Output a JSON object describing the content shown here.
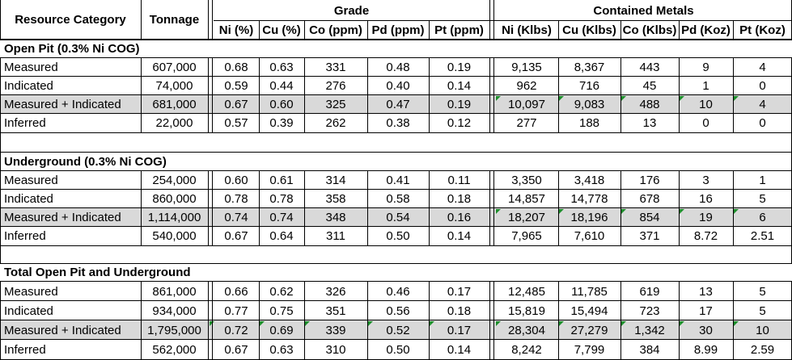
{
  "table": {
    "headers": {
      "resource_category": "Resource Category",
      "tonnage": "Tonnage",
      "grade_group": "Grade",
      "contained_group": "Contained Metals",
      "grade_columns": [
        "Ni (%)",
        "Cu (%)",
        "Co (ppm)",
        "Pd (ppm)",
        "Pt (ppm)"
      ],
      "contained_columns": [
        "Ni (Klbs)",
        "Cu (Klbs)",
        "Co (Klbs)",
        "Pd (Koz)",
        "Pt (Koz)"
      ]
    },
    "sections": [
      {
        "title": "Open Pit (0.3% Ni COG)",
        "rows": [
          {
            "category": "Measured",
            "tonnage": "607,000",
            "grade": [
              "0.68",
              "0.63",
              "331",
              "0.48",
              "0.19"
            ],
            "contained": [
              "9,135",
              "8,367",
              "443",
              "9",
              "4"
            ]
          },
          {
            "category": "Indicated",
            "tonnage": "74,000",
            "grade": [
              "0.59",
              "0.44",
              "276",
              "0.40",
              "0.14"
            ],
            "contained": [
              "962",
              "716",
              "45",
              "1",
              "0"
            ]
          },
          {
            "category": "Measured + Indicated",
            "tonnage": "681,000",
            "grade": [
              "0.67",
              "0.60",
              "325",
              "0.47",
              "0.19"
            ],
            "contained": [
              "10,097",
              "9,083",
              "488",
              "10",
              "4"
            ]
          },
          {
            "category": "Inferred",
            "tonnage": "22,000",
            "grade": [
              "0.57",
              "0.39",
              "262",
              "0.38",
              "0.12"
            ],
            "contained": [
              "277",
              "188",
              "13",
              "0",
              "0"
            ]
          }
        ]
      },
      {
        "title": "Underground (0.3% Ni COG)",
        "rows": [
          {
            "category": "Measured",
            "tonnage": "254,000",
            "grade": [
              "0.60",
              "0.61",
              "314",
              "0.41",
              "0.11"
            ],
            "contained": [
              "3,350",
              "3,418",
              "176",
              "3",
              "1"
            ]
          },
          {
            "category": "Indicated",
            "tonnage": "860,000",
            "grade": [
              "0.78",
              "0.78",
              "358",
              "0.58",
              "0.18"
            ],
            "contained": [
              "14,857",
              "14,778",
              "678",
              "16",
              "5"
            ]
          },
          {
            "category": "Measured + Indicated",
            "tonnage": "1,114,000",
            "grade": [
              "0.74",
              "0.74",
              "348",
              "0.54",
              "0.16"
            ],
            "contained": [
              "18,207",
              "18,196",
              "854",
              "19",
              "6"
            ]
          },
          {
            "category": "Inferred",
            "tonnage": "540,000",
            "grade": [
              "0.67",
              "0.64",
              "311",
              "0.50",
              "0.14"
            ],
            "contained": [
              "7,965",
              "7,610",
              "371",
              "8.72",
              "2.51"
            ]
          }
        ]
      },
      {
        "title": "Total Open Pit and Underground",
        "rows": [
          {
            "category": "Measured",
            "tonnage": "861,000",
            "grade": [
              "0.66",
              "0.62",
              "326",
              "0.46",
              "0.17"
            ],
            "contained": [
              "12,485",
              "11,785",
              "619",
              "13",
              "5"
            ]
          },
          {
            "category": "Indicated",
            "tonnage": "934,000",
            "grade": [
              "0.77",
              "0.75",
              "351",
              "0.56",
              "0.18"
            ],
            "contained": [
              "15,819",
              "15,494",
              "723",
              "17",
              "5"
            ]
          },
          {
            "category": "Measured + Indicated",
            "tonnage": "1,795,000",
            "grade": [
              "0.72",
              "0.69",
              "339",
              "0.52",
              "0.17"
            ],
            "contained": [
              "28,304",
              "27,279",
              "1,342",
              "30",
              "10"
            ]
          },
          {
            "category": "Inferred",
            "tonnage": "562,000",
            "grade": [
              "0.67",
              "0.63",
              "310",
              "0.50",
              "0.14"
            ],
            "contained": [
              "8,242",
              "7,799",
              "384",
              "8.99",
              "2.59"
            ]
          }
        ]
      }
    ]
  },
  "colors": {
    "shaded_row": "#d9d9d9",
    "comment_marker": "#1e8f2c",
    "rule": "#000000"
  }
}
